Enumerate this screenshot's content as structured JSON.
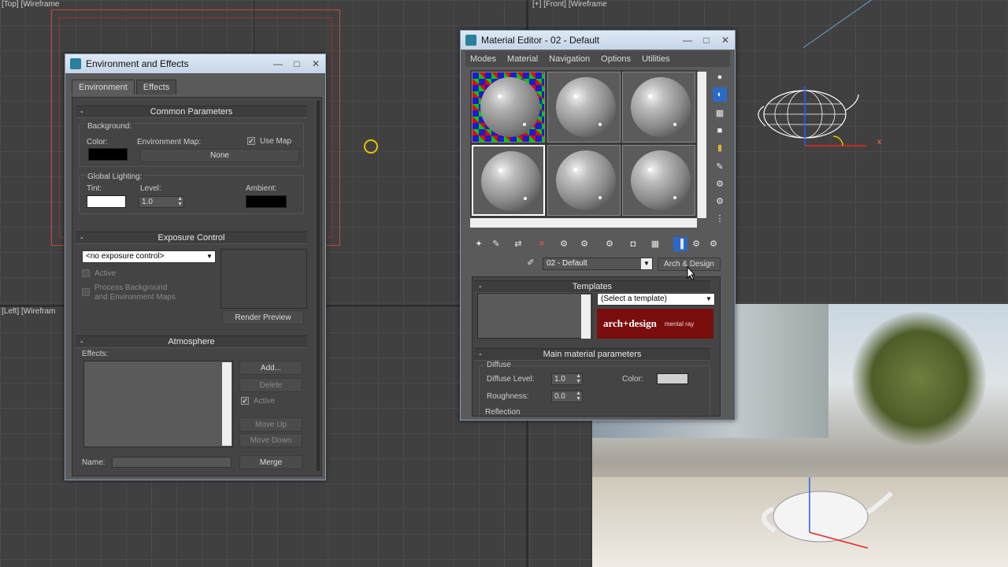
{
  "viewports": {
    "top_label": "[Top] [Wireframe",
    "front_label": "[+] [Front] [Wireframe",
    "left_label": "[Left] [Wirefram"
  },
  "env_window": {
    "title": "Environment and Effects",
    "tabs": [
      "Environment",
      "Effects"
    ],
    "common": {
      "header": "Common Parameters",
      "background_label": "Background:",
      "color_label": "Color:",
      "env_map_label": "Environment Map:",
      "use_map_label": "Use Map",
      "use_map_checked": "✓",
      "env_map_value": "None",
      "global_lighting_label": "Global Lighting:",
      "tint_label": "Tint:",
      "level_label": "Level:",
      "level_value": "1.0",
      "ambient_label": "Ambient:",
      "bg_color": "#000000",
      "tint_color": "#ffffff",
      "ambient_color": "#000000"
    },
    "exposure": {
      "header": "Exposure Control",
      "dropdown_value": "<no exposure control>",
      "active_label": "Active",
      "process_bg_label_1": "Process Background",
      "process_bg_label_2": "and Environment Maps",
      "render_preview": "Render Preview"
    },
    "atmosphere": {
      "header": "Atmosphere",
      "effects_label": "Effects:",
      "add": "Add...",
      "delete": "Delete",
      "active_label": "Active",
      "active_checked": "✓",
      "move_up": "Move Up",
      "move_down": "Move Down",
      "name_label": "Name:",
      "merge": "Merge"
    }
  },
  "mat_window": {
    "title": "Material Editor - 02 - Default",
    "menu": [
      "Modes",
      "Material",
      "Navigation",
      "Options",
      "Utilities"
    ],
    "material_name": "02 - Default",
    "material_type": "Arch & Design",
    "templates": {
      "header": "Templates",
      "select_value": "(Select a template)",
      "banner_main": "arch+design",
      "banner_sub": "mental ray"
    },
    "main_params": {
      "header": "Main material parameters",
      "diffuse_label": "Diffuse",
      "diffuse_level_label": "Diffuse Level:",
      "diffuse_level_value": "1.0",
      "color_label": "Color:",
      "roughness_label": "Roughness:",
      "roughness_value": "0.0",
      "reflection_label": "Reflection",
      "diffuse_color": "#d0d0d0"
    }
  },
  "axis_labels": {
    "x": "x"
  }
}
